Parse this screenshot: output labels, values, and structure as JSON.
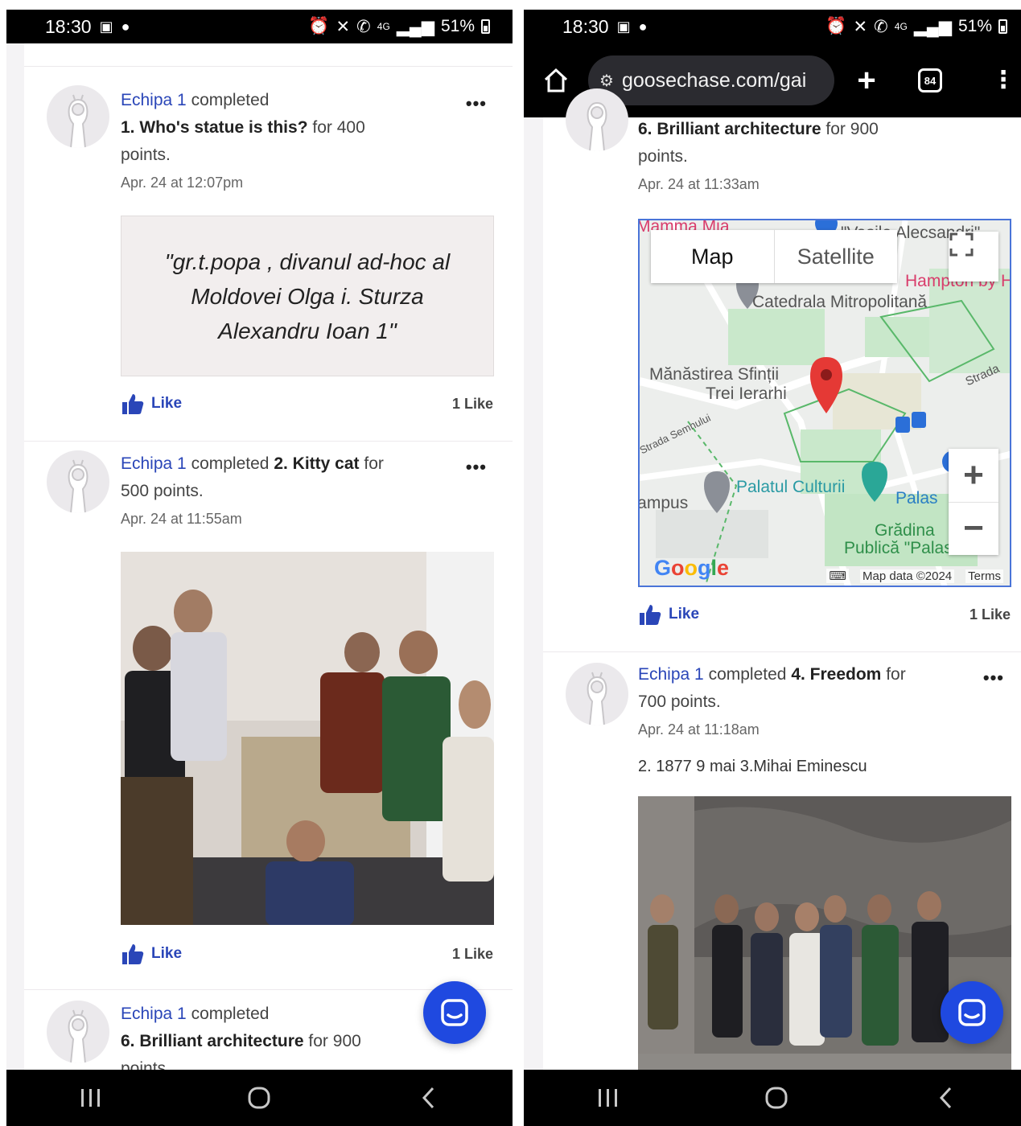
{
  "status": {
    "time": "18:30",
    "battery": "51%",
    "network": "4G"
  },
  "browser": {
    "url": "goosechase.com/gai",
    "tab_count": "84"
  },
  "left_feed": {
    "post1": {
      "team": "Echipa 1",
      "verb": "completed",
      "mission": "1. Who's statue is this?",
      "for_text": "for 400",
      "points_text": "points.",
      "date": "Apr. 24 at 12:07pm",
      "answer_quote": "\"gr.t.popa , divanul ad-hoc al Moldovei Olga i. Sturza Alexandru Ioan 1\"",
      "like_label": "Like",
      "like_count": "1 Like"
    },
    "post2": {
      "team": "Echipa 1",
      "verb": "completed",
      "mission": "2. Kitty cat",
      "for_text": "for",
      "points_text": "500 points.",
      "date": "Apr. 24 at 11:55am",
      "like_label": "Like",
      "like_count": "1 Like"
    },
    "post3": {
      "team": "Echipa 1",
      "verb": "completed",
      "mission": "6. Brilliant architecture",
      "for_text": "for 900",
      "points_text": "points."
    }
  },
  "right_feed": {
    "post1": {
      "mission": "6. Brilliant architecture",
      "for_text": "for 900",
      "points_text": "points.",
      "date": "Apr. 24 at 11:33am",
      "map": {
        "tab_map": "Map",
        "tab_satellite": "Satellite",
        "labels": {
          "l1": "Mamma Mia",
          "l2": "\"Vasile Alecsandri\"",
          "l3": "Hampton by H",
          "l4": "Catedrala Mitropolitană",
          "l5": "Mănăstirea Sfinții",
          "l6": "Trei Ierarhi",
          "l7": "Strada",
          "l8": "Strada Semnului",
          "l9": "Palatul Culturii",
          "l10": "Campus",
          "l11": "Palas",
          "l12": "Grădina",
          "l13": "Publică \"Palas\""
        },
        "map_data": "Map data ©2024",
        "terms": "Terms",
        "google": [
          "G",
          "o",
          "o",
          "g",
          "l",
          "e"
        ]
      },
      "like_label": "Like",
      "like_count": "1 Like"
    },
    "post2": {
      "team": "Echipa 1",
      "verb": "completed",
      "mission": "4. Freedom",
      "for_text": "for",
      "points_text": "700 points.",
      "date": "Apr. 24 at 11:18am",
      "answer": "2. 1877 9 mai 3.Mihai Eminescu"
    }
  }
}
